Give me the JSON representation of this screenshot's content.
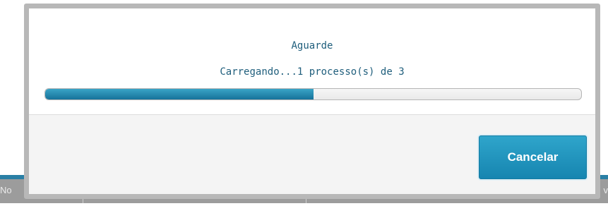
{
  "background": {
    "left_edge_text": "No",
    "right_edge_text": "v"
  },
  "modal": {
    "title": "Aguarde",
    "status_text": "Carregando...1 processo(s) de 3",
    "progress_fraction": 0.5,
    "cancel_label": "Cancelar"
  },
  "colors": {
    "accent": "#1c8ab5",
    "text": "#1f5e7c",
    "progress_fill": "#1f87b0"
  }
}
